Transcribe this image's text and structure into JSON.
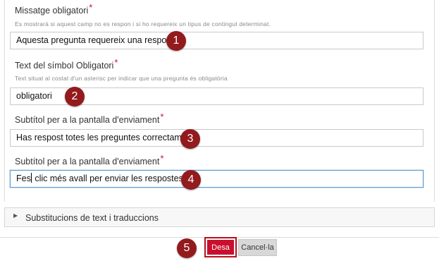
{
  "fields": [
    {
      "label": "Missatge obligatori",
      "help": "Es mostrarà si aquest camp no es respon i si ho requereix un tipus de contingut determinat.",
      "value": "Aquesta pregunta requereix una resposta",
      "marker": "1"
    },
    {
      "label": "Text del símbol Obligatori",
      "help": "Text situat al costat d'un asterisc per indicar que una pregunta és obligatòria",
      "value": "obligatori",
      "marker": "2"
    },
    {
      "label": "Subtítol per a la pantalla d'enviament",
      "help": "",
      "value": "Has respost totes les preguntes correctament",
      "marker": "3"
    },
    {
      "label": "Subtítol per a la pantalla d'enviament",
      "help": "",
      "value_before_caret": "Fes",
      "value_after_caret": " clic més avall per enviar les respostes",
      "marker": "4"
    }
  ],
  "required_mark": "*",
  "section": {
    "title": "Substitucions de text i traduccions"
  },
  "actions": {
    "save_label": "Desa",
    "cancel_label": "Cancel·la",
    "save_marker": "5"
  },
  "colors": {
    "required": "#c8102e",
    "marker": "#931a1d",
    "save_button": "#c8102e"
  }
}
